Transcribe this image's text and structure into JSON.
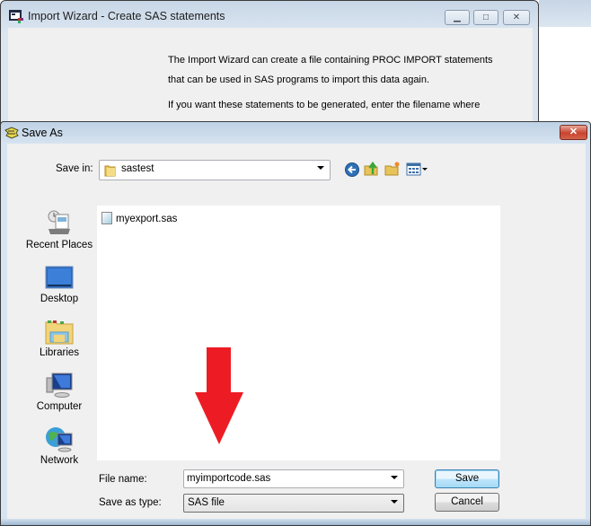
{
  "background_window": {
    "title": "Import Wizard - Create SAS statements",
    "icon": "sas-app-icon",
    "body_lines": [
      "The Import Wizard can create a file containing PROC IMPORT statements",
      "that can be used in SAS programs to import this data again.",
      "If you want these statements to be generated, enter the filename where"
    ],
    "controls": {
      "minimize": "▁",
      "maximize": "□",
      "close": "✕"
    }
  },
  "dialog": {
    "title": "Save As",
    "icon": "save-as-icon",
    "close": "✕",
    "save_in_label": "Save in:",
    "save_in_value": "sastest",
    "toolbar": [
      "back-icon",
      "up-folder-icon",
      "new-folder-icon",
      "views-menu-icon"
    ],
    "places": [
      {
        "label": "Recent Places",
        "icon": "recent-places-icon"
      },
      {
        "label": "Desktop",
        "icon": "desktop-icon"
      },
      {
        "label": "Libraries",
        "icon": "libraries-icon"
      },
      {
        "label": "Computer",
        "icon": "computer-icon"
      },
      {
        "label": "Network",
        "icon": "network-icon"
      }
    ],
    "files": [
      {
        "name": "myexport.sas",
        "icon": "sas-file-icon"
      }
    ],
    "file_name_label": "File name:",
    "file_name_value": "myimportcode.sas",
    "save_as_type_label": "Save as type:",
    "save_as_type_value": "SAS file",
    "save_button": "Save",
    "cancel_button": "Cancel"
  },
  "annotation": {
    "type": "red-arrow",
    "color": "#ed1c24",
    "points_to": "file-name-input"
  }
}
